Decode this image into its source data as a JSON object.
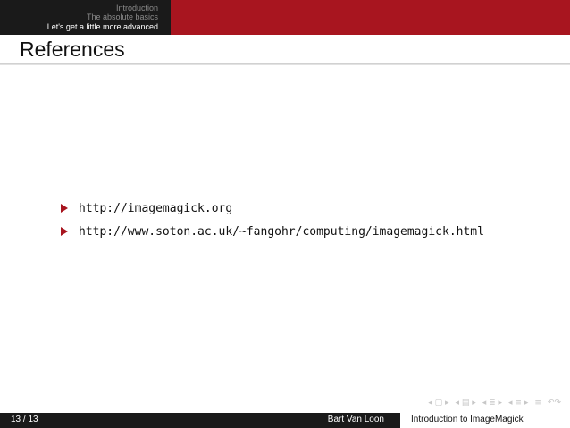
{
  "header": {
    "nav": [
      "Introduction",
      "The absolute basics",
      "Let's get a little more advanced"
    ],
    "active_index": 2
  },
  "slide": {
    "title": "References",
    "references": [
      "http://imagemagick.org",
      "http://www.soton.ac.uk/~fangohr/computing/imagemagick.html"
    ]
  },
  "footer": {
    "page": "13 / 13",
    "author": "Bart Van Loon",
    "presentation_title": "Introduction to ImageMagick"
  },
  "colors": {
    "accent": "#a8151f",
    "dark": "#1a1a1a"
  }
}
